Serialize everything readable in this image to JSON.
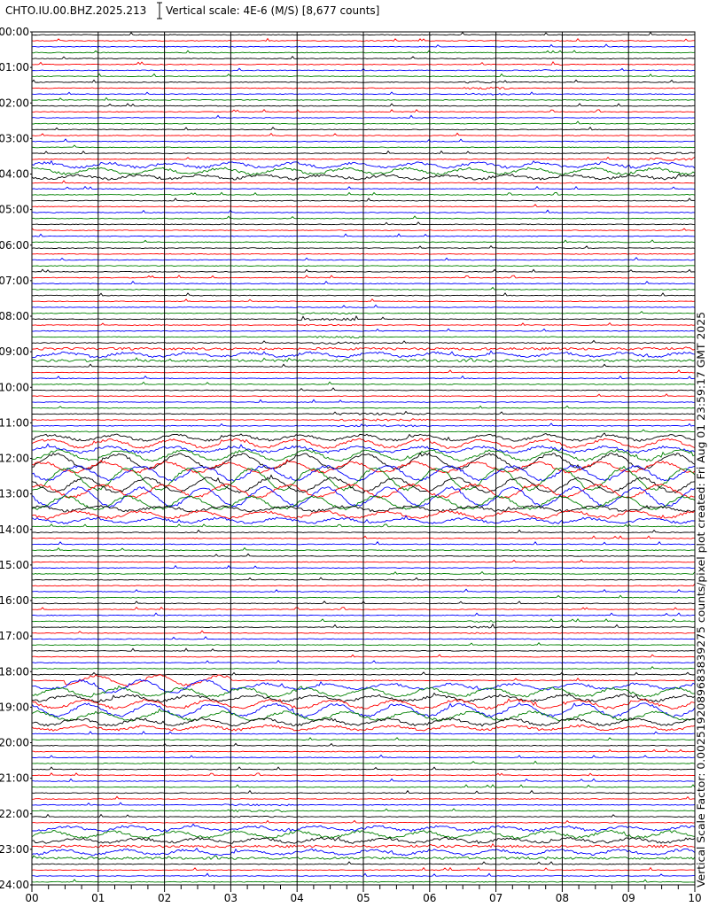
{
  "header": {
    "station": "CHTO.IU.00.BHZ.2025.213",
    "scale": "Vertical scale: 4E-6 (M/S) [8,677 counts]"
  },
  "side_label": "Vertical Scale Factor: 0.0025192089683839275 counts/pixel plot created: Fri Aug 01 23:59:17 GMT 2025",
  "chart_data": {
    "type": "line",
    "title": "CHTO.IU.00.BHZ.2025.213",
    "xlabel": "",
    "ylabel": "",
    "x_ticks": [
      "00",
      "01",
      "02",
      "03",
      "04",
      "05",
      "06",
      "07",
      "08",
      "09",
      "10"
    ],
    "x_range_min": [
      0,
      10
    ],
    "hour_labels": [
      "00:00",
      "01:00",
      "02:00",
      "03:00",
      "04:00",
      "05:00",
      "06:00",
      "07:00",
      "08:00",
      "09:00",
      "10:00",
      "11:00",
      "12:00",
      "13:00",
      "14:00",
      "15:00",
      "16:00",
      "17:00",
      "18:00",
      "19:00",
      "20:00",
      "21:00",
      "22:00",
      "23:00",
      "24:00"
    ],
    "traces_per_hour": 6,
    "trace_colors": [
      "#000000",
      "#ff0000",
      "#0000ff",
      "#008000"
    ],
    "events": [
      {
        "hour": 1.0,
        "min_start": 7.5,
        "min_end": 8.0,
        "amp": 0.3
      },
      {
        "hour": 1.5,
        "min_start": 6.5,
        "min_end": 7.2,
        "amp": 0.5
      },
      {
        "hour": 3.5,
        "min_start": 9.3,
        "min_end": 10.0,
        "amp": 0.5
      },
      {
        "hour": 3.8,
        "min_start": 0.0,
        "min_end": 10.0,
        "amp": 0.9
      },
      {
        "hour": 8.0,
        "min_start": 4.0,
        "min_end": 4.9,
        "amp": 0.4
      },
      {
        "hour": 8.6,
        "min_start": 4.2,
        "min_end": 5.0,
        "amp": 0.5
      },
      {
        "hour": 9.0,
        "min_start": 0.0,
        "min_end": 10.0,
        "amp": 0.6
      },
      {
        "hour": 10.8,
        "min_start": 4.6,
        "min_end": 6.0,
        "amp": 0.5
      },
      {
        "hour": 11.5,
        "min_start": 0.0,
        "min_end": 10.0,
        "amp": 1.2
      },
      {
        "hour": 12.0,
        "min_start": 0.0,
        "min_end": 10.0,
        "amp": 2.2
      },
      {
        "hour": 12.5,
        "min_start": 0.0,
        "min_end": 10.0,
        "amp": 3.2
      },
      {
        "hour": 13.0,
        "min_start": 0.0,
        "min_end": 10.0,
        "amp": 2.8
      },
      {
        "hour": 13.5,
        "min_start": 0.0,
        "min_end": 10.0,
        "amp": 1.0
      },
      {
        "hour": 16.6,
        "min_start": 6.6,
        "min_end": 7.0,
        "amp": 0.4
      },
      {
        "hour": 18.3,
        "min_start": 0.5,
        "min_end": 3.0,
        "amp": 2.0
      },
      {
        "hour": 18.5,
        "min_start": 0.0,
        "min_end": 10.0,
        "amp": 1.2
      },
      {
        "hour": 19.0,
        "min_start": 0.0,
        "min_end": 10.0,
        "amp": 1.8
      },
      {
        "hour": 19.3,
        "min_start": 0.0,
        "min_end": 10.0,
        "amp": 1.0
      },
      {
        "hour": 21.8,
        "min_start": 2.9,
        "min_end": 3.9,
        "amp": 0.4
      },
      {
        "hour": 22.5,
        "min_start": 0.0,
        "min_end": 10.0,
        "amp": 0.9
      },
      {
        "hour": 23.0,
        "min_start": 0.0,
        "min_end": 10.0,
        "amp": 0.7
      }
    ]
  }
}
